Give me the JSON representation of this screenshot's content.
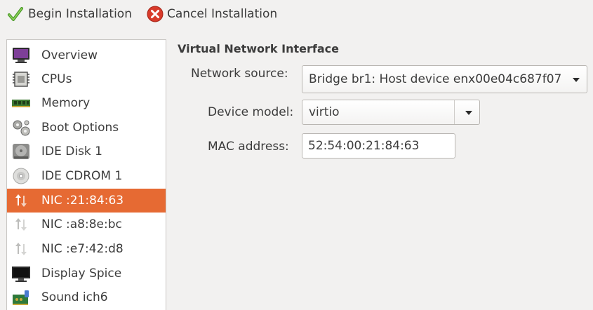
{
  "toolbar": {
    "begin_label": "Begin Installation",
    "cancel_label": "Cancel Installation",
    "begin_icon": "checkmark-icon",
    "cancel_icon": "cancel-icon"
  },
  "sidebar": {
    "items": [
      {
        "label": "Overview",
        "icon": "monitor-icon"
      },
      {
        "label": "CPUs",
        "icon": "cpu-icon"
      },
      {
        "label": "Memory",
        "icon": "memory-icon"
      },
      {
        "label": "Boot Options",
        "icon": "gears-icon"
      },
      {
        "label": "IDE Disk 1",
        "icon": "disk-icon"
      },
      {
        "label": "IDE CDROM 1",
        "icon": "cdrom-icon"
      },
      {
        "label": "NIC :21:84:63",
        "icon": "nic-icon",
        "selected": true
      },
      {
        "label": "NIC :a8:8e:bc",
        "icon": "nic-icon"
      },
      {
        "label": "NIC :e7:42:d8",
        "icon": "nic-icon"
      },
      {
        "label": "Display Spice",
        "icon": "display-icon"
      },
      {
        "label": "Sound ich6",
        "icon": "sound-card-icon"
      }
    ]
  },
  "main": {
    "section_title": "Virtual Network Interface",
    "network_source": {
      "label": "Network source:",
      "value": "Bridge br1: Host device enx00e04c687f07"
    },
    "device_model": {
      "label": "Device model:",
      "value": "virtio"
    },
    "mac_address": {
      "label": "MAC address:",
      "value": "52:54:00:21:84:63"
    }
  },
  "colors": {
    "selection": "#e66a33",
    "window_bg": "#f2f1f0"
  }
}
